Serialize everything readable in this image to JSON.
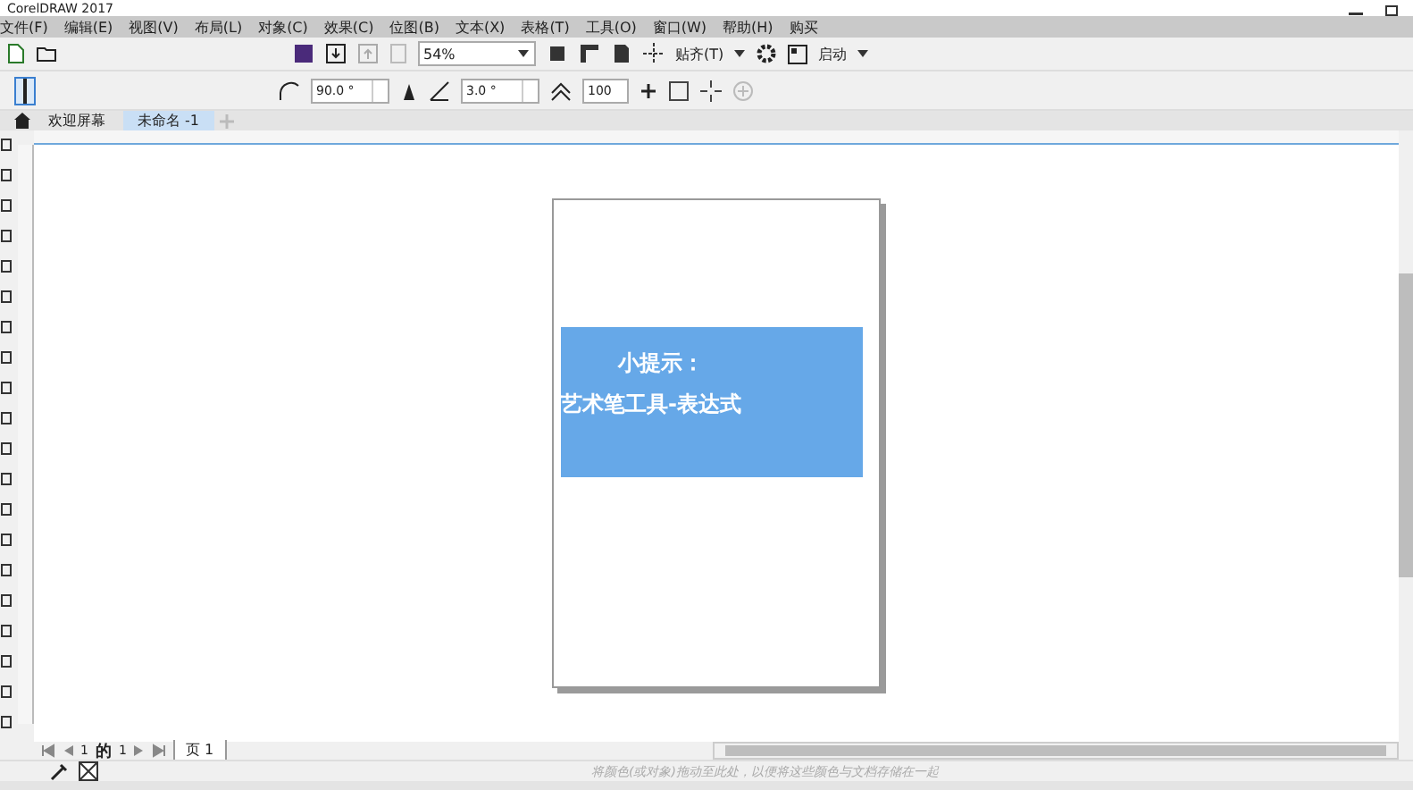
{
  "window": {
    "title": "CorelDRAW 2017"
  },
  "menu": [
    "文件(F)",
    "编辑(E)",
    "视图(V)",
    "布局(L)",
    "对象(C)",
    "效果(C)",
    "位图(B)",
    "文本(X)",
    "表格(T)",
    "工具(O)",
    "窗口(W)",
    "帮助(H)",
    "购买"
  ],
  "toolbar": {
    "zoom": "54%",
    "snap": "贴齐(T)",
    "launch": "启动"
  },
  "property_bar": {
    "angle": "90.0 °",
    "width_angle": "3.0 °",
    "smoothing": "100"
  },
  "doc_tabs": [
    {
      "label": "欢迎屏幕",
      "selected": false
    },
    {
      "label": "未命名 -1",
      "selected": true
    }
  ],
  "page": {
    "lines": [
      "小提示：",
      "艺术笔工具-表达式"
    ]
  },
  "page_nav": {
    "current": "1",
    "of": "的",
    "total": "1",
    "tab": "页 1"
  },
  "palette_hint": "将颜色(或对象)拖动至此处，以便将这些颜色与文档存储在一起"
}
